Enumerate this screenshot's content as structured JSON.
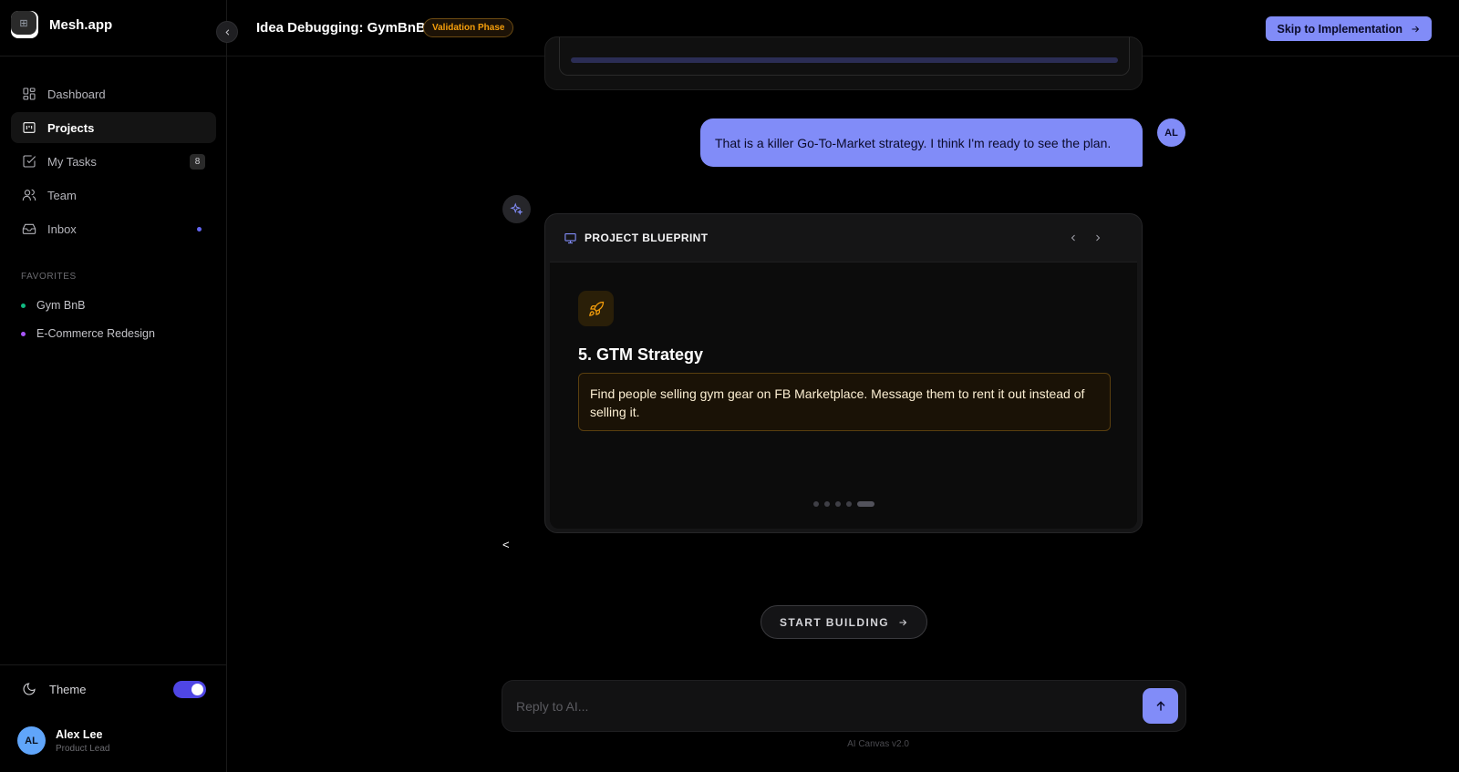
{
  "app": {
    "name": "Mesh.app"
  },
  "header": {
    "title": "Idea Debugging: GymBnB",
    "phase_badge": "Validation Phase",
    "skip_button": "Skip to Implementation"
  },
  "sidebar": {
    "nav": [
      {
        "label": "Dashboard",
        "icon": "dashboard-icon"
      },
      {
        "label": "Projects",
        "icon": "projects-icon",
        "active": true
      },
      {
        "label": "My Tasks",
        "icon": "tasks-icon",
        "badge": "8"
      },
      {
        "label": "Team",
        "icon": "team-icon"
      },
      {
        "label": "Inbox",
        "icon": "inbox-icon",
        "unread_dot": true
      }
    ],
    "favorites_title": "FAVORITES",
    "favorites": [
      {
        "label": "Gym BnB",
        "color": "#10b981"
      },
      {
        "label": "E-Commerce Redesign",
        "color": "#a855f7"
      }
    ],
    "theme_label": "Theme",
    "theme_dark": true,
    "user": {
      "initials": "AL",
      "name": "Alex Lee",
      "role": "Product Lead"
    }
  },
  "chat": {
    "user_message": "That is a killer Go-To-Market strategy. I think I'm ready to see the plan.",
    "user_initials": "AL",
    "blueprint": {
      "title": "PROJECT BLUEPRINT",
      "step_title": "5. GTM Strategy",
      "step_text": "Find people selling gym gear on FB Marketplace. Message them to rent it out instead of selling it.",
      "slides_total": 5,
      "slide_active": 5
    },
    "stray_text": "<",
    "start_button": "START BUILDING",
    "composer_placeholder": "Reply to AI...",
    "footer_version": "AI Canvas v2.0"
  },
  "colors": {
    "accent": "#818cf8",
    "phase": "#f59e0b",
    "toggle": "#4f46e5"
  }
}
